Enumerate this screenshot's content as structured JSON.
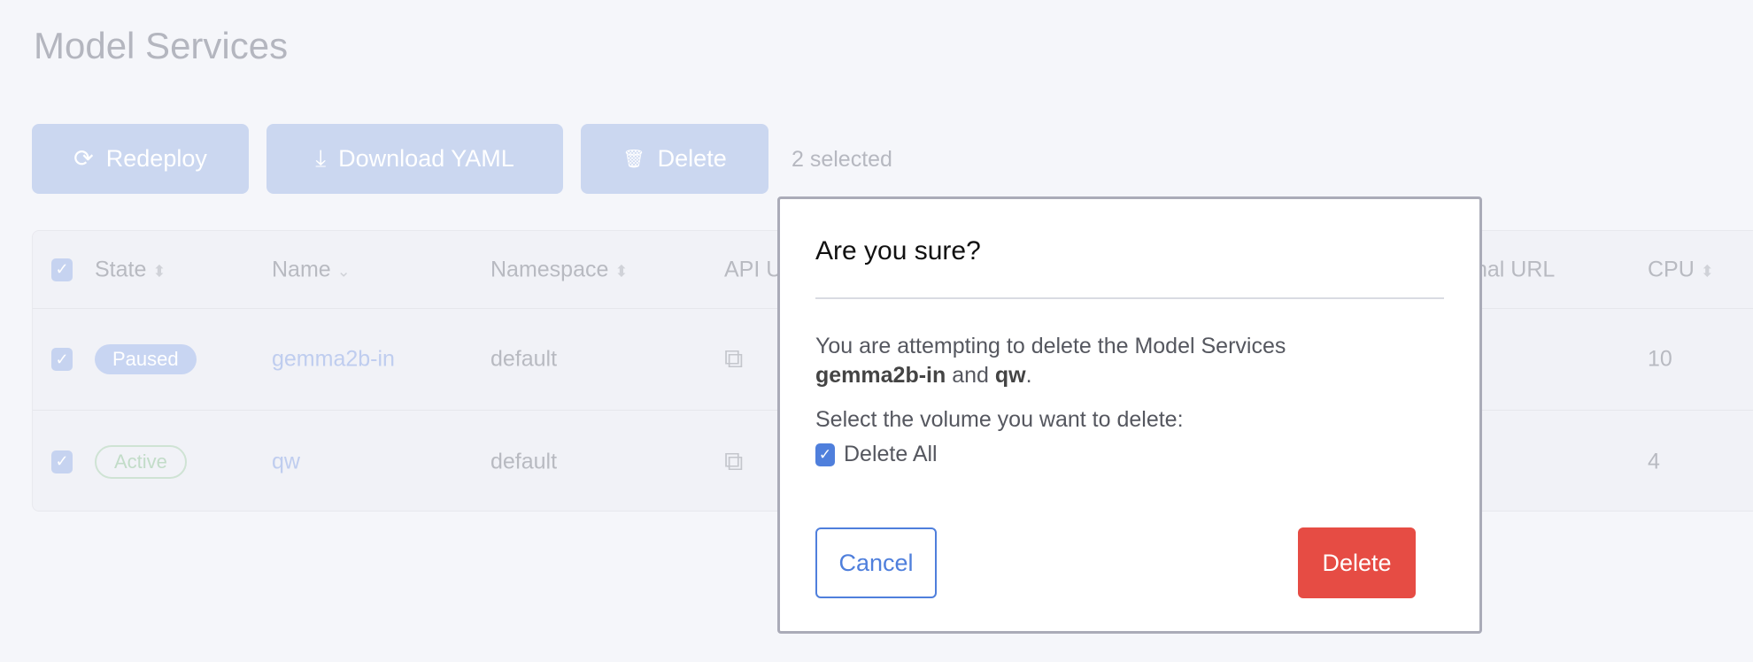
{
  "page": {
    "title": "Model Services"
  },
  "toolbar": {
    "redeploy": "Redeploy",
    "download": "Download YAML",
    "delete": "Delete",
    "selected": "2 selected"
  },
  "table": {
    "headers": {
      "state": "State",
      "name": "Name",
      "namespace": "Namespace",
      "api": "API U",
      "external": "nal URL",
      "cpu": "CPU"
    },
    "rows": [
      {
        "state": "Paused",
        "name": "gemma2b-in",
        "namespace": "default",
        "cpu": "10",
        "checked": true
      },
      {
        "state": "Active",
        "name": "qw",
        "namespace": "default",
        "cpu": "4",
        "checked": true
      }
    ]
  },
  "modal": {
    "title": "Are you sure?",
    "message_prefix": "You are attempting to delete the Model Services",
    "name1": "gemma2b-in",
    "and": " and ",
    "name2": "qw",
    "period": ".",
    "select_label": "Select the volume you want to delete:",
    "delete_all": "Delete All",
    "delete_all_checked": true,
    "cancel": "Cancel",
    "confirm": "Delete"
  },
  "colors": {
    "accent": "#4f7fdc",
    "danger": "#e64c44"
  }
}
